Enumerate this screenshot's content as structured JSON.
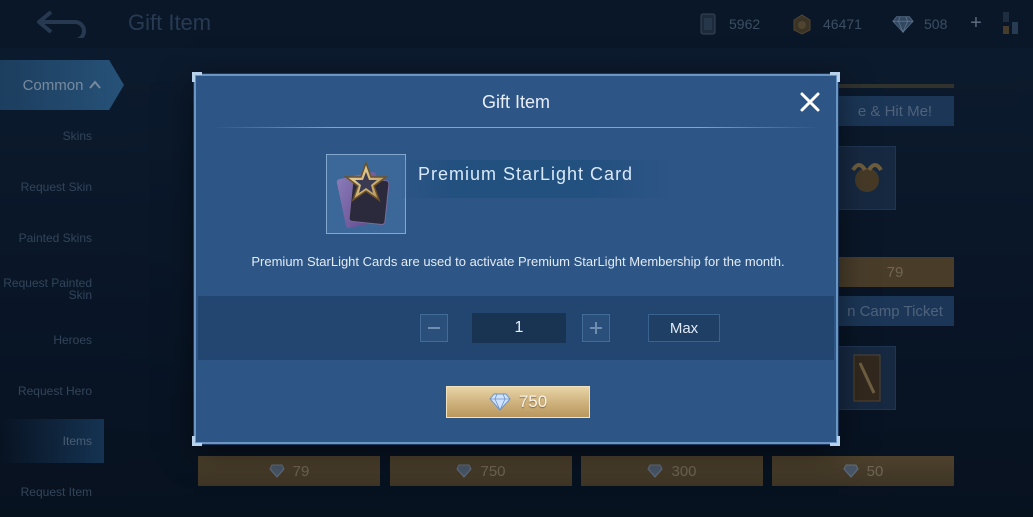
{
  "app": {
    "page_title": "Gift Item",
    "resources": [
      {
        "icon": "ticket-icon",
        "value": "5962"
      },
      {
        "icon": "battle-point-icon",
        "value": "46471"
      },
      {
        "icon": "diamond-icon",
        "value": "508"
      }
    ],
    "plus_label": "+"
  },
  "sidebar": {
    "category": "Common",
    "items": [
      {
        "label": "Skins"
      },
      {
        "label": "Request Skin"
      },
      {
        "label": "Painted Skins"
      },
      {
        "label": "Request Painted Skin"
      },
      {
        "label": "Heroes"
      },
      {
        "label": "Request Hero"
      },
      {
        "label": "Items"
      },
      {
        "label": "Request Item"
      }
    ],
    "active_index": 6
  },
  "shop": {
    "card_titles": [
      "e & Hit Me!",
      "n Camp Ticket"
    ],
    "top_price": "79",
    "bottom_prices": [
      "79",
      "750",
      "300",
      "50"
    ]
  },
  "modal": {
    "title": "Gift Item",
    "item_name": "Premium StarLight Card",
    "description": "Premium StarLight Cards are used to activate Premium StarLight Membership for the month.",
    "quantity": "1",
    "minus_label": "−",
    "plus_label": "+",
    "max_label": "Max",
    "price": "750",
    "price_icon": "diamond-icon"
  },
  "colors": {
    "modal_bg": "#2d5585",
    "gold_button": "#cdb07a",
    "accent_blue": "#3a79ad"
  }
}
